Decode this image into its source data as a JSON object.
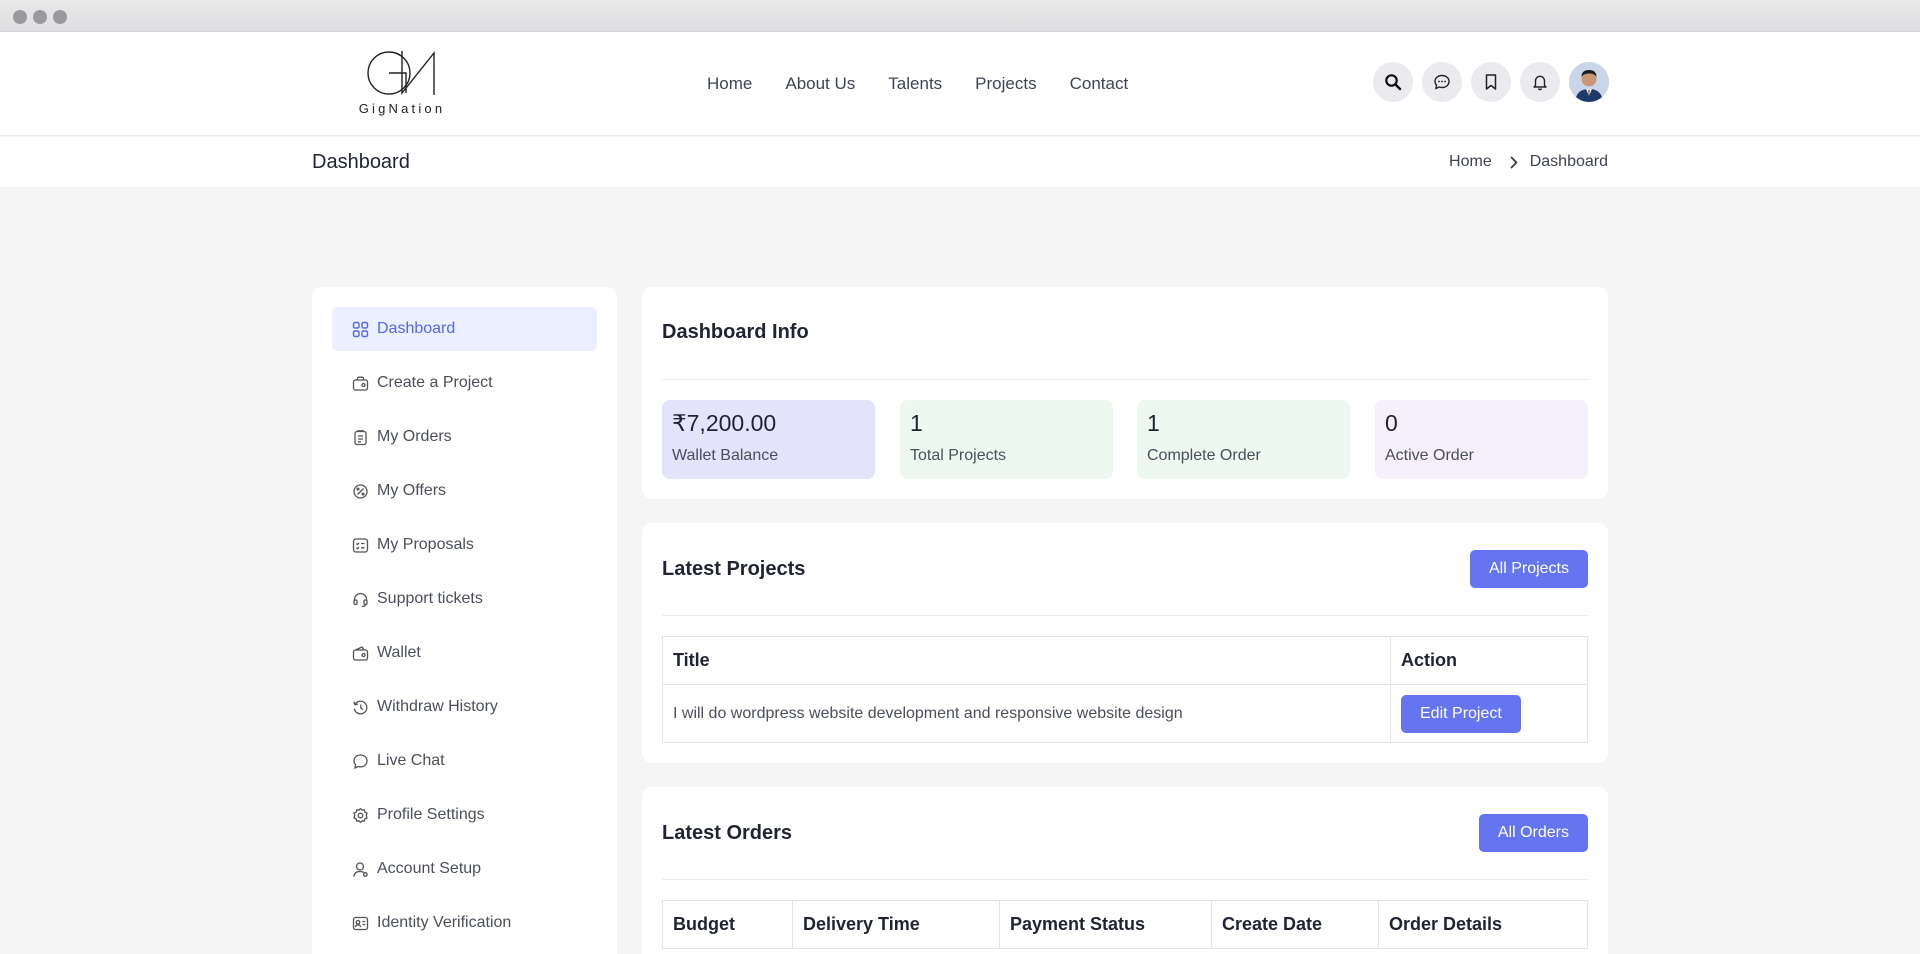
{
  "brand": {
    "logo_text": "GigNation"
  },
  "nav": {
    "items": [
      {
        "label": "Home"
      },
      {
        "label": "About Us"
      },
      {
        "label": "Talents"
      },
      {
        "label": "Projects"
      },
      {
        "label": "Contact"
      }
    ]
  },
  "header_icons": [
    "search-icon",
    "chat-icon",
    "bookmark-icon",
    "bell-icon"
  ],
  "subbar": {
    "title": "Dashboard",
    "breadcrumb": [
      "Home",
      "Dashboard"
    ]
  },
  "sidebar": {
    "items": [
      {
        "label": "Dashboard",
        "icon": "grid-icon",
        "active": true
      },
      {
        "label": "Create a Project",
        "icon": "briefcase-icon"
      },
      {
        "label": "My Orders",
        "icon": "clipboard-icon"
      },
      {
        "label": "My Offers",
        "icon": "badge-icon"
      },
      {
        "label": "My Proposals",
        "icon": "list-icon"
      },
      {
        "label": "Support tickets",
        "icon": "headset-icon"
      },
      {
        "label": "Wallet",
        "icon": "wallet-icon"
      },
      {
        "label": "Withdraw History",
        "icon": "history-icon"
      },
      {
        "label": "Live Chat",
        "icon": "message-icon"
      },
      {
        "label": "Profile Settings",
        "icon": "gear-icon"
      },
      {
        "label": "Account Setup",
        "icon": "user-icon"
      },
      {
        "label": "Identity Verification",
        "icon": "id-card-icon"
      }
    ]
  },
  "dashboard_info": {
    "title": "Dashboard Info",
    "stats": [
      {
        "value": "₹7,200.00",
        "label": "Wallet Balance",
        "color": "#e3e3fb"
      },
      {
        "value": "1",
        "label": "Total Projects",
        "color": "#edf8f1"
      },
      {
        "value": "1",
        "label": "Complete Order",
        "color": "#edf8f1"
      },
      {
        "value": "0",
        "label": "Active Order",
        "color": "#f6effc"
      }
    ]
  },
  "latest_projects": {
    "title": "Latest Projects",
    "button": "All Projects",
    "columns": [
      "Title",
      "Action"
    ],
    "rows": [
      {
        "title": "I will do wordpress website development and responsive website design",
        "action": "Edit Project"
      }
    ]
  },
  "latest_orders": {
    "title": "Latest Orders",
    "button": "All Orders",
    "columns": [
      "Budget",
      "Delivery Time",
      "Payment Status",
      "Create Date",
      "Order Details"
    ]
  },
  "colors": {
    "accent": "#6574ef",
    "active_bg": "#eceffd",
    "active_text": "#5468e8"
  }
}
